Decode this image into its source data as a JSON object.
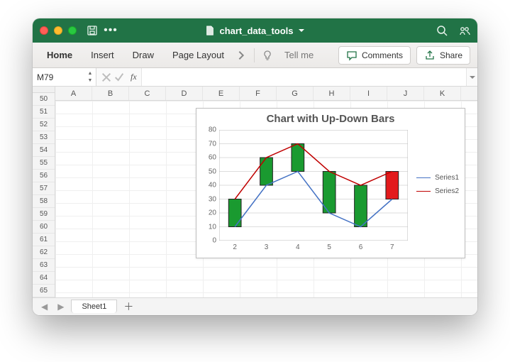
{
  "window": {
    "title": "chart_data_tools"
  },
  "ribbon": {
    "tabs": [
      "Home",
      "Insert",
      "Draw",
      "Page Layout"
    ],
    "tellme": "Tell me",
    "comments": "Comments",
    "share": "Share"
  },
  "formula_bar": {
    "name_box": "M79",
    "fx": "fx",
    "value": ""
  },
  "grid": {
    "cols": [
      "A",
      "B",
      "C",
      "D",
      "E",
      "F",
      "G",
      "H",
      "I",
      "J",
      "K"
    ],
    "first_row": 50,
    "last_row": 65
  },
  "sheets": {
    "active": "Sheet1"
  },
  "chart_data": {
    "type": "line",
    "title": "Chart with Up-Down Bars",
    "xlabel": "",
    "ylabel": "",
    "ylim": [
      0,
      80
    ],
    "yticks": [
      0,
      10,
      20,
      30,
      40,
      50,
      60,
      70,
      80
    ],
    "x": [
      2,
      3,
      4,
      5,
      6,
      7
    ],
    "series": [
      {
        "name": "Series1",
        "values": [
          10,
          40,
          50,
          20,
          10,
          30
        ],
        "color": "#4472c4"
      },
      {
        "name": "Series2",
        "values": [
          30,
          60,
          70,
          50,
          40,
          50
        ],
        "color": "#c00000"
      }
    ],
    "updown_bars": [
      {
        "x": 2,
        "open": 10,
        "close": 30,
        "dir": "up"
      },
      {
        "x": 3,
        "open": 40,
        "close": 60,
        "dir": "up"
      },
      {
        "x": 4,
        "open": 50,
        "close": 70,
        "dir": "up"
      },
      {
        "x": 5,
        "open": 20,
        "close": 50,
        "dir": "up"
      },
      {
        "x": 6,
        "open": 10,
        "close": 40,
        "dir": "up"
      },
      {
        "x": 7,
        "open": 30,
        "close": 50,
        "dir": "down"
      }
    ]
  }
}
